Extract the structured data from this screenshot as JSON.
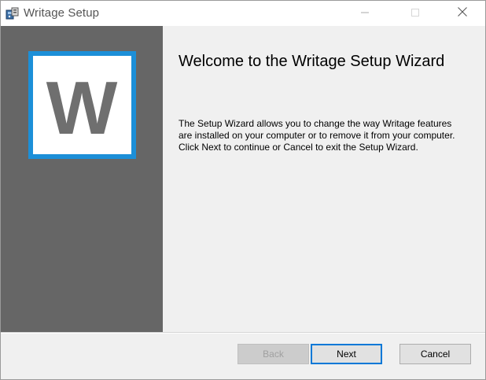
{
  "window": {
    "title": "Writage Setup",
    "controls": {
      "minimize_icon": "minimize-icon",
      "maximize_icon": "maximize-icon",
      "close_icon": "close-icon"
    }
  },
  "sidebar": {
    "logo_icon": "writage-w-logo-icon",
    "logo_letter": "W",
    "logo_border_color": "#1c8fd8",
    "background_color": "#666666"
  },
  "main": {
    "heading": "Welcome to the Writage Setup Wizard",
    "description": "The Setup Wizard allows you to change the way Writage features are installed on your computer or to remove it from your computer. Click Next to continue or Cancel to exit the Setup Wizard."
  },
  "footer": {
    "back_label": "Back",
    "next_label": "Next",
    "cancel_label": "Cancel",
    "back_enabled": false,
    "accent_color": "#0078d7"
  }
}
